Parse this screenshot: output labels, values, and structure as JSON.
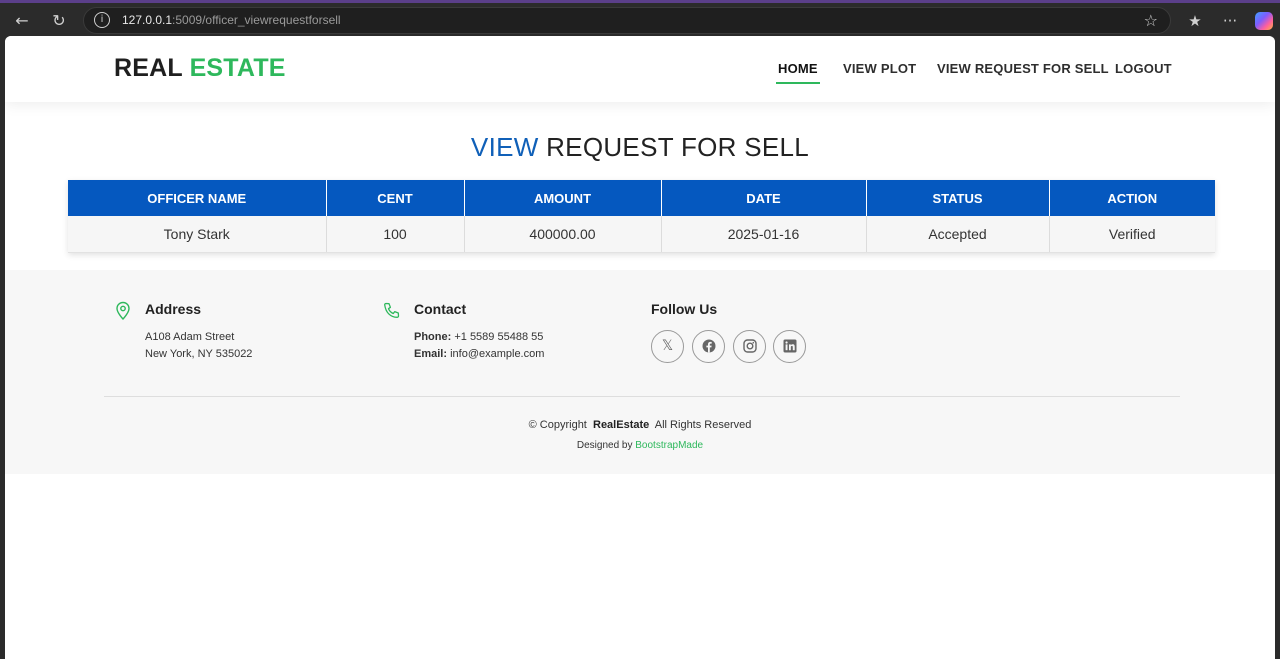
{
  "browser": {
    "url_host": "127.0.0.1",
    "url_path": ":5009/officer_viewrequestforsell",
    "icons": [
      "back-icon",
      "refresh-icon",
      "site-info-icon",
      "favorite-star-icon",
      "favorites-icon",
      "more-icon",
      "copilot-icon"
    ]
  },
  "header": {
    "logo_main": "REAL",
    "logo_accent": "ESTATE",
    "nav": [
      "HOME",
      "VIEW PLOT",
      "VIEW REQUEST FOR SELL",
      "LOGOUT"
    ],
    "active_nav": "HOME"
  },
  "page": {
    "title_highlight": "VIEW",
    "title_rest": "REQUEST FOR SELL"
  },
  "table": {
    "columns": [
      "OFFICER NAME",
      "CENT",
      "AMOUNT",
      "DATE",
      "STATUS",
      "ACTION"
    ],
    "rows": [
      [
        "Tony Stark",
        "100",
        "400000.00",
        "2025-01-16",
        "Accepted",
        "Verified"
      ]
    ]
  },
  "footer": {
    "address": {
      "heading": "Address",
      "line1": "A108 Adam Street",
      "line2": "New York, NY 535022"
    },
    "contact": {
      "heading": "Contact",
      "phone_label": "Phone:",
      "phone": "+1 5589 55488 55",
      "email_label": "Email:",
      "email": "info@example.com"
    },
    "follow": {
      "heading": "Follow Us",
      "icons": [
        "x-twitter-icon",
        "facebook-icon",
        "instagram-icon",
        "linkedin-icon"
      ]
    },
    "copyright_prefix": "© Copyright",
    "copyright_brand": "RealEstate",
    "copyright_suffix": "All Rights Reserved",
    "designed_prefix": "Designed by",
    "designed_link": "BootstrapMade"
  },
  "colors": {
    "accent_green": "#2eb85c",
    "table_header_blue": "#0558bf",
    "title_blue": "#1060b8"
  }
}
